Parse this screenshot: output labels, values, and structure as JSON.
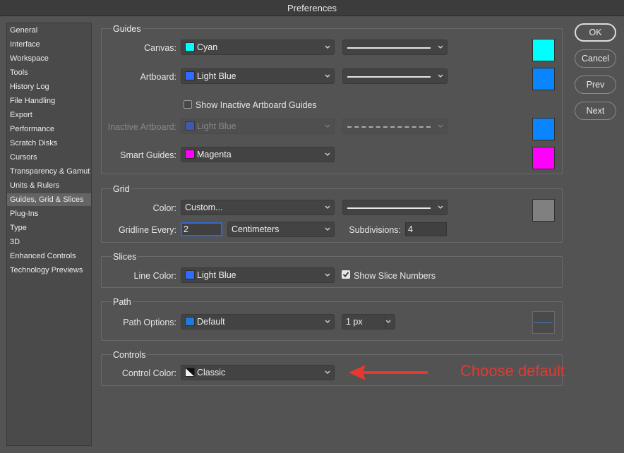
{
  "window": {
    "title": "Preferences"
  },
  "sidebar": {
    "items": [
      {
        "label": "General"
      },
      {
        "label": "Interface"
      },
      {
        "label": "Workspace"
      },
      {
        "label": "Tools"
      },
      {
        "label": "History Log"
      },
      {
        "label": "File Handling"
      },
      {
        "label": "Export"
      },
      {
        "label": "Performance"
      },
      {
        "label": "Scratch Disks"
      },
      {
        "label": "Cursors"
      },
      {
        "label": "Transparency & Gamut"
      },
      {
        "label": "Units & Rulers"
      },
      {
        "label": "Guides, Grid & Slices",
        "selected": true
      },
      {
        "label": "Plug-Ins"
      },
      {
        "label": "Type"
      },
      {
        "label": "3D"
      },
      {
        "label": "Enhanced Controls"
      },
      {
        "label": "Technology Previews"
      }
    ]
  },
  "guides": {
    "title": "Guides",
    "canvas": {
      "label": "Canvas:",
      "color": "Cyan",
      "swatch": "#00ffff",
      "line_style": "solid"
    },
    "artboard": {
      "label": "Artboard:",
      "color": "Light Blue",
      "swatch": "#2f6bff",
      "big_swatch": "#0a84ff",
      "line_style": "solid"
    },
    "show_inactive": {
      "label": "Show Inactive Artboard Guides",
      "checked": false
    },
    "inactive_artboard": {
      "label": "Inactive Artboard:",
      "color": "Light Blue",
      "swatch": "#3a5fd0",
      "big_swatch": "#0a84ff",
      "line_style": "dashed",
      "disabled": true
    },
    "smart_guides": {
      "label": "Smart Guides:",
      "color": "Magenta",
      "swatch": "#ff00ff"
    }
  },
  "grid": {
    "title": "Grid",
    "color": {
      "label": "Color:",
      "value": "Custom...",
      "big_swatch": "#808080",
      "line_style": "solid"
    },
    "gridline_every": {
      "label": "Gridline Every:",
      "value": "2",
      "unit": "Centimeters"
    },
    "subdivisions": {
      "label": "Subdivisions:",
      "value": "4"
    }
  },
  "slices": {
    "title": "Slices",
    "line_color": {
      "label": "Line Color:",
      "value": "Light Blue",
      "swatch": "#2f6bff"
    },
    "show_numbers": {
      "label": "Show Slice Numbers",
      "checked": true
    }
  },
  "path": {
    "title": "Path",
    "options": {
      "label": "Path Options:",
      "value": "Default",
      "swatch": "#1f7ae0",
      "width": "1 px",
      "preview_color": "#3d7bd6"
    }
  },
  "controls": {
    "title": "Controls",
    "control_color": {
      "label": "Control Color:",
      "value": "Classic"
    }
  },
  "buttons": {
    "ok": "OK",
    "cancel": "Cancel",
    "prev": "Prev",
    "next": "Next"
  },
  "annotation": {
    "text": "Choose default",
    "color": "#e6382f"
  }
}
